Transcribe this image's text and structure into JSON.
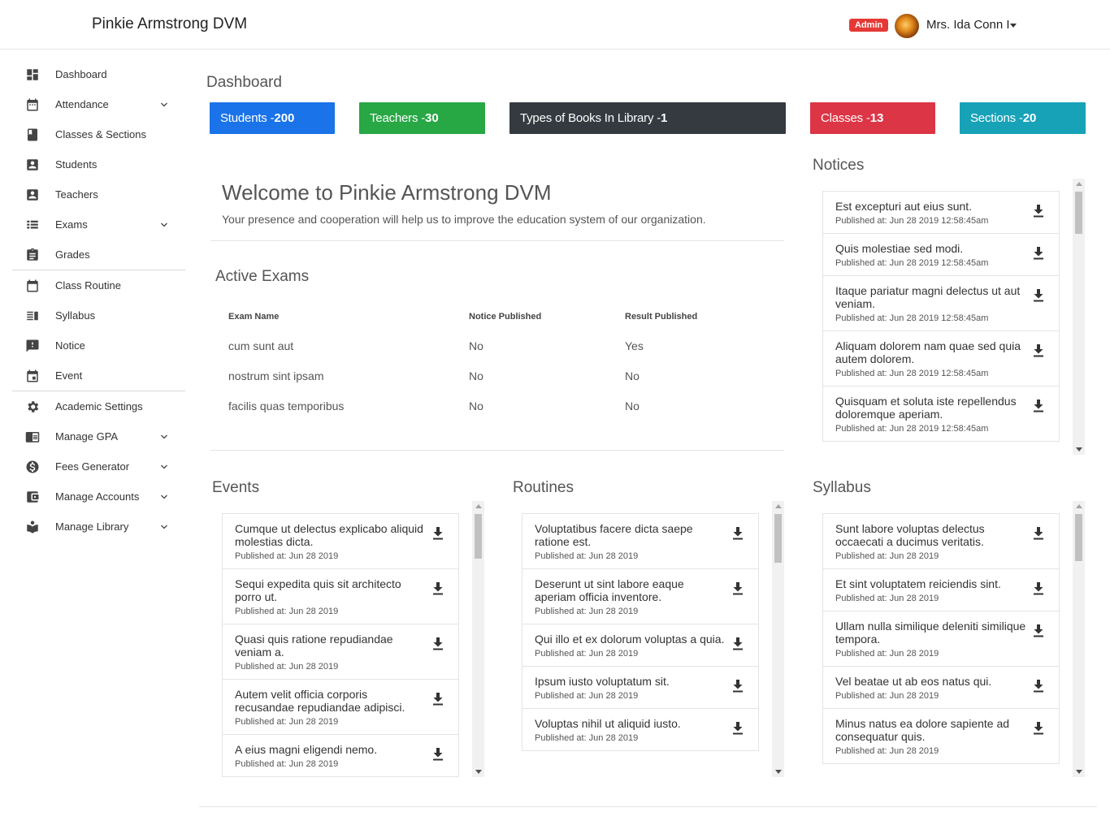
{
  "header": {
    "brand": "Pinkie Armstrong DVM",
    "badge": "Admin",
    "user_name": "Mrs. Ida Conn I"
  },
  "sidebar": {
    "items": [
      {
        "label": "Dashboard",
        "icon": "dashboard-icon"
      },
      {
        "label": "Attendance",
        "icon": "calendar-icon"
      },
      {
        "label": "Classes & Sections",
        "icon": "book-icon"
      },
      {
        "label": "Students",
        "icon": "contact-card-icon"
      },
      {
        "label": "Teachers",
        "icon": "contact-card-icon"
      },
      {
        "label": "Exams",
        "icon": "view-list-icon"
      },
      {
        "label": "Grades",
        "icon": "clipboard-icon"
      },
      {
        "label": "Class Routine",
        "icon": "calendar-blank-icon"
      },
      {
        "label": "Syllabus",
        "icon": "syllabus-icon"
      },
      {
        "label": "Notice",
        "icon": "feedback-icon"
      },
      {
        "label": "Event",
        "icon": "event-icon"
      },
      {
        "label": "Academic Settings",
        "icon": "gear-icon"
      },
      {
        "label": "Manage GPA",
        "icon": "chrome-reader-icon"
      },
      {
        "label": "Fees Generator",
        "icon": "dollar-icon"
      },
      {
        "label": "Manage Accounts",
        "icon": "wallet-icon"
      },
      {
        "label": "Manage Library",
        "icon": "library-icon"
      }
    ]
  },
  "dashboard": {
    "title": "Dashboard",
    "stats": [
      {
        "label": "Students - ",
        "value": "200",
        "color": "#1a73e8"
      },
      {
        "label": "Teachers - ",
        "value": "30",
        "color": "#28a745"
      },
      {
        "label": "Types of Books In Library - ",
        "value": "1",
        "color": "#343a40"
      },
      {
        "label": "Classes - ",
        "value": "13",
        "color": "#dc3545"
      },
      {
        "label": "Sections - ",
        "value": "20",
        "color": "#17a2b8"
      }
    ]
  },
  "welcome": {
    "title": "Welcome to Pinkie Armstrong DVM",
    "subtitle": "Your presence and cooperation will help us to improve the education system of our organization."
  },
  "active_exams": {
    "title": "Active Exams",
    "headers": [
      "Exam Name",
      "Notice Published",
      "Result Published"
    ],
    "rows": [
      [
        "cum sunt aut",
        "No",
        "Yes"
      ],
      [
        "nostrum sint ipsam",
        "No",
        "No"
      ],
      [
        "facilis quas temporibus",
        "No",
        "No"
      ]
    ]
  },
  "notices": {
    "title": "Notices",
    "items": [
      {
        "title": "Est excepturi aut eius sunt.",
        "date": "Published at: Jun 28 2019 12:58:45am"
      },
      {
        "title": "Quis molestiae sed modi.",
        "date": "Published at: Jun 28 2019 12:58:45am"
      },
      {
        "title": "Itaque pariatur magni delectus ut aut veniam.",
        "date": "Published at: Jun 28 2019 12:58:45am"
      },
      {
        "title": "Aliquam dolorem nam quae sed quia autem dolorem.",
        "date": "Published at: Jun 28 2019 12:58:45am"
      },
      {
        "title": "Quisquam et soluta iste repellendus doloremque aperiam.",
        "date": "Published at: Jun 28 2019 12:58:45am"
      }
    ]
  },
  "events": {
    "title": "Events",
    "items": [
      {
        "title": "Cumque ut delectus explicabo aliquid molestias dicta.",
        "date": "Published at: Jun 28 2019"
      },
      {
        "title": "Sequi expedita quis sit architecto porro ut.",
        "date": "Published at: Jun 28 2019"
      },
      {
        "title": "Quasi quis ratione repudiandae veniam a.",
        "date": "Published at: Jun 28 2019"
      },
      {
        "title": "Autem velit officia corporis recusandae repudiandae adipisci.",
        "date": "Published at: Jun 28 2019"
      },
      {
        "title": "A eius magni eligendi nemo.",
        "date": "Published at: Jun 28 2019"
      }
    ]
  },
  "routines": {
    "title": "Routines",
    "items": [
      {
        "title": "Voluptatibus facere dicta saepe ratione est.",
        "date": "Published at: Jun 28 2019"
      },
      {
        "title": "Deserunt ut sint labore eaque aperiam officia inventore.",
        "date": "Published at: Jun 28 2019"
      },
      {
        "title": "Qui illo et ex dolorum voluptas a quia.",
        "date": "Published at: Jun 28 2019"
      },
      {
        "title": "Ipsum iusto voluptatum sit.",
        "date": "Published at: Jun 28 2019"
      },
      {
        "title": "Voluptas nihil ut aliquid iusto.",
        "date": "Published at: Jun 28 2019"
      }
    ]
  },
  "syllabus": {
    "title": "Syllabus",
    "items": [
      {
        "title": "Sunt labore voluptas delectus occaecati a ducimus veritatis.",
        "date": "Published at: Jun 28 2019"
      },
      {
        "title": "Et sint voluptatem reiciendis sint.",
        "date": "Published at: Jun 28 2019"
      },
      {
        "title": "Ullam nulla similique deleniti similique tempora.",
        "date": "Published at: Jun 28 2019"
      },
      {
        "title": "Vel beatae ut ab eos natus qui.",
        "date": "Published at: Jun 28 2019"
      },
      {
        "title": "Minus natus ea dolore sapiente ad consequatur quis.",
        "date": "Published at: Jun 28 2019"
      }
    ]
  }
}
